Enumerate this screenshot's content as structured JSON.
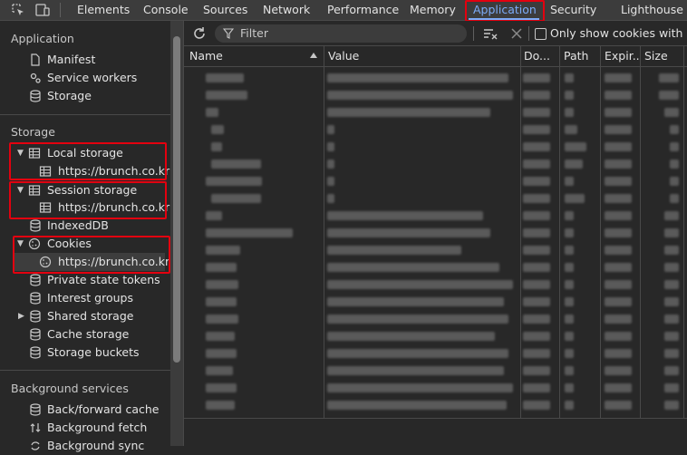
{
  "tabs": [
    "Elements",
    "Console",
    "Sources",
    "Network",
    "Performance",
    "Memory",
    "Application",
    "Security",
    "Lighthouse"
  ],
  "active_tab": "Application",
  "sidebar": {
    "application_heading": "Application",
    "application_items": [
      "Manifest",
      "Service workers",
      "Storage"
    ],
    "storage_heading": "Storage",
    "local_storage": "Local storage",
    "local_storage_origin": "https://brunch.co.kr",
    "session_storage": "Session storage",
    "session_storage_origin": "https://brunch.co.kr",
    "indexeddb": "IndexedDB",
    "cookies": "Cookies",
    "cookies_origin": "https://brunch.co.kr",
    "more_items": [
      "Private state tokens",
      "Interest groups",
      "Shared storage",
      "Cache storage",
      "Storage buckets"
    ],
    "background_heading": "Background services",
    "background_items": [
      "Back/forward cache",
      "Background fetch",
      "Background sync"
    ]
  },
  "toolbar": {
    "filter_placeholder": "Filter",
    "only_show_label": "Only show cookies with an"
  },
  "table": {
    "columns": [
      "Name",
      "Value",
      "Do...",
      "Path",
      "Expir...",
      "Size"
    ]
  },
  "colors": {
    "accent": "#7cacf8",
    "highlight_box": "#e3000f",
    "background": "#282828"
  }
}
